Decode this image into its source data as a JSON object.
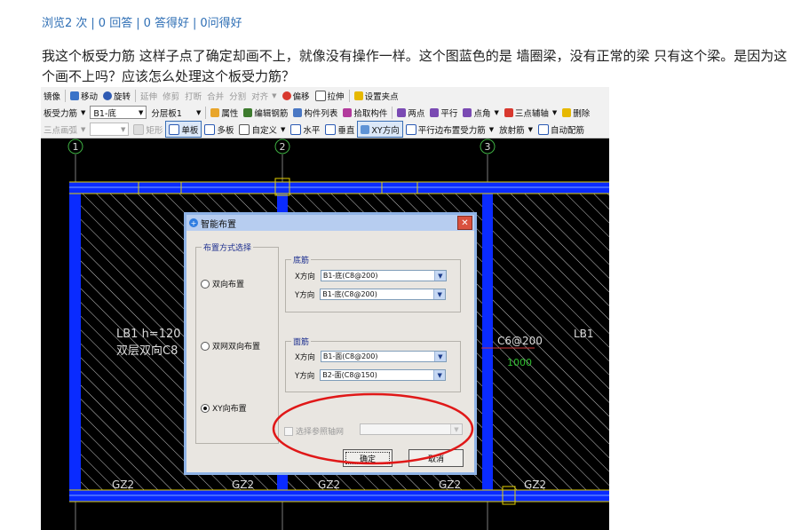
{
  "stats": {
    "views": "浏览2 次",
    "answers": "0 回答",
    "good_answers": "0 答得好",
    "asked_good": "0问得好",
    "separator": "|"
  },
  "question": {
    "text": "我这个板受力筋 这样子点了确定却画不上，就像没有操作一样。这个图蓝色的是 墙圈梁，没有正常的梁 只有这个梁。是因为这个画不上吗？应该怎么处理这个板受力筋？"
  },
  "toolbar1": {
    "mirror": "镜像",
    "move": "移动",
    "rotate": "旋转",
    "extend": "延伸",
    "trim": "修剪",
    "break": "打断",
    "merge": "合并",
    "split": "分割",
    "align": "对齐",
    "offset": "偏移",
    "stretch": "拉伸",
    "set_grip": "设置夹点"
  },
  "toolbar2": {
    "category": "板受力筋",
    "rebar": "B1-底",
    "layer": "分层板1",
    "attribute": "属性",
    "edit_rebar": "编辑钢筋",
    "component_list": "构件列表",
    "pick_component": "拾取构件",
    "two_points": "两点",
    "parallel": "平行",
    "point_angle": "点角",
    "three_point_axis": "三点辅轴",
    "delete": "删除"
  },
  "toolbar3": {
    "three_point_arc": "三点画弧",
    "empty_select": "",
    "rectangle": "矩形",
    "single_slab": "单板",
    "multi_slab": "多板",
    "custom": "自定义",
    "horizontal": "水平",
    "vertical": "垂直",
    "xy_direction": "XY方向",
    "parallel_edge": "平行边布置受力筋",
    "radial": "放射筋",
    "auto_rebar": "自动配筋"
  },
  "cad": {
    "axis_1": "1",
    "axis_2": "2",
    "axis_3": "3",
    "slab_label_1": "LB1 h=120",
    "slab_label_2": "双层双向C8",
    "rebar_label": "C6@200",
    "dim_label": "1000",
    "slab_label_right": "LB1",
    "gz_1": "GZ2",
    "gz_2": "GZ2",
    "gz_3": "GZ2",
    "gz_4": "GZ2",
    "gz_5": "GZ2",
    "wall_color": "#0a2bff",
    "highlight_color": "#e3d100",
    "annotation_color": "#e01818"
  },
  "dialog": {
    "title": "智能布置",
    "close": "✕",
    "layout_group": "布置方式选择",
    "opt_bidirectional": "双向布置",
    "opt_double_layer": "双网双向布置",
    "opt_xy": "XY向布置",
    "bottom_group": "底筋",
    "bottom_x_label": "X方向",
    "bottom_x_value": "B1-底(C8@200)",
    "bottom_y_label": "Y方向",
    "bottom_y_value": "B1-底(C8@200)",
    "top_group": "面筋",
    "top_x_label": "X方向",
    "top_x_value": "B1-面(C8@200)",
    "top_y_label": "Y方向",
    "top_y_value": "B2-面(C8@150)",
    "ref_axis": "选择参照轴网",
    "ref_axis_value": "",
    "ok": "确定",
    "cancel": "取消",
    "selected_option": "XY向布置"
  },
  "icons": [
    "move-icon",
    "rotate-icon",
    "offset-icon",
    "stretch-icon",
    "grip-icon",
    "attribute-icon",
    "edit-rebar-icon",
    "list-icon",
    "pick-icon",
    "two-points-icon",
    "parallel-icon",
    "point-angle-icon",
    "axis-icon",
    "delete-icon",
    "slab-icon",
    "custom-icon",
    "horizontal-icon",
    "vertical-icon",
    "xy-icon",
    "dialog-icon",
    "close-icon"
  ]
}
